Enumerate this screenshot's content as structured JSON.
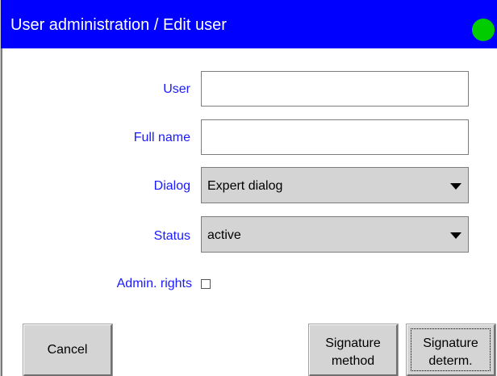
{
  "titlebar": {
    "title": "User administration / Edit user",
    "status_color": "#00cc00"
  },
  "form": {
    "user": {
      "label": "User",
      "value": ""
    },
    "full_name": {
      "label": "Full name",
      "value": ""
    },
    "dialog": {
      "label": "Dialog",
      "selected": "Expert dialog"
    },
    "status": {
      "label": "Status",
      "selected": "active"
    },
    "admin_rights": {
      "label": "Admin. rights",
      "checked": false
    }
  },
  "buttons": {
    "cancel": "Cancel",
    "signature_method": {
      "line1": "Signature",
      "line2": "method"
    },
    "signature_determ": {
      "line1": "Signature",
      "line2": "determ."
    }
  },
  "icons": {
    "status_indicator": "status-dot-icon",
    "dropdown_arrow": "triangle-down-icon"
  },
  "colors": {
    "titlebar_bg": "#0000ff",
    "label_text": "#1a1aff",
    "control_bg": "#d4d4d4"
  }
}
